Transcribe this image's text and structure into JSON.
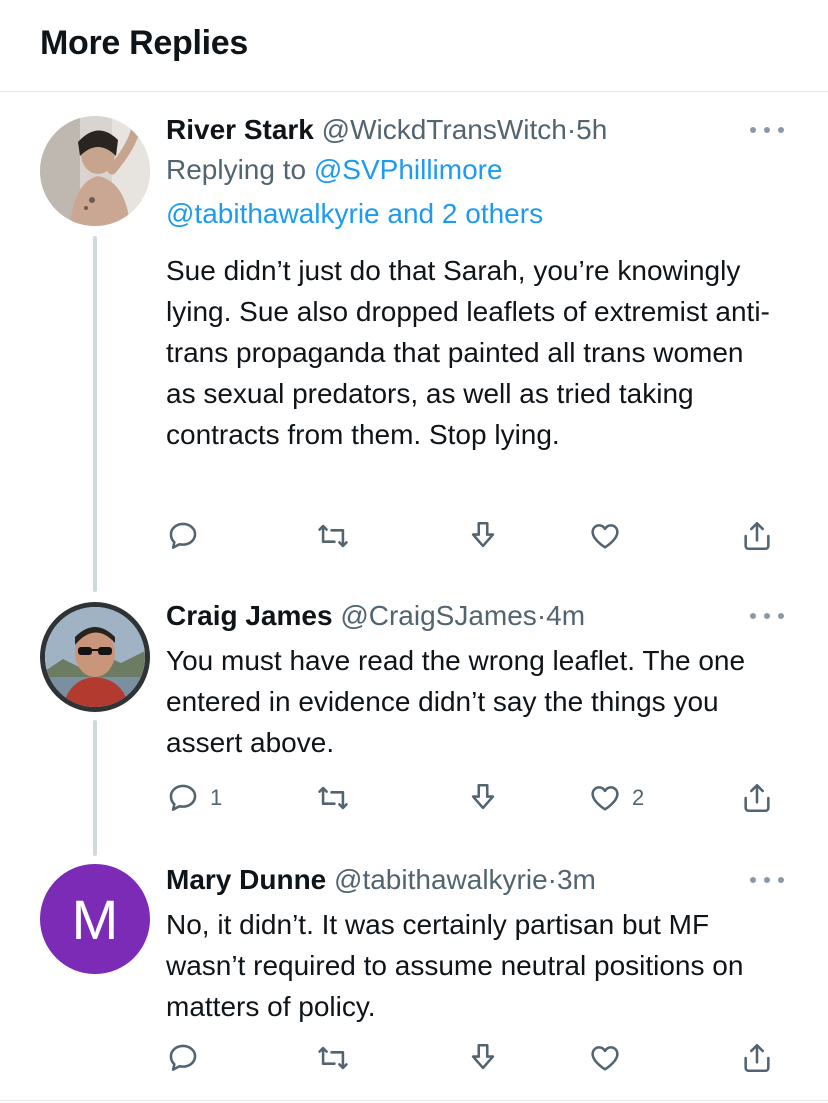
{
  "header": {
    "title": "More Replies"
  },
  "tweets": [
    {
      "name": "River Stark",
      "handle": "@WickdTransWitch",
      "dot": "·",
      "time": "5h",
      "replying_prefix": "Replying to ",
      "replying_to_first": "@SVPhillimore",
      "replying_to_rest": "@tabithawalkyrie and 2 others",
      "text": "Sue didn’t just do that Sarah, you’re knowingly lying. Sue also dropped leaflets of extremist anti-trans propaganda that painted all trans women as sexual predators, as well as tried taking contracts from them. Stop lying.",
      "reply_count": "",
      "retweet_count": "",
      "like_count": ""
    },
    {
      "name": "Craig James",
      "handle": "@CraigSJames",
      "dot": "·",
      "time": "4m",
      "text": "You must have read the wrong leaflet. The one entered in evidence didn’t say the things you assert above.",
      "reply_count": "1",
      "retweet_count": "",
      "like_count": "2"
    },
    {
      "name": "Mary Dunne",
      "handle": "@tabithawalkyrie",
      "dot": "·",
      "time": "3m",
      "avatar_letter": "M",
      "text": "No, it didn’t. It was certainly partisan but MF wasn’t required to assume neutral positions on matters of policy.",
      "reply_count": "",
      "retweet_count": "",
      "like_count": ""
    }
  ],
  "icons": {
    "reply": "reply-icon",
    "retweet": "retweet-icon",
    "downvote": "downvote-icon",
    "like": "heart-icon",
    "share": "share-icon",
    "more": "more-options-icon"
  },
  "colors": {
    "link": "#1d9bf0",
    "secondary_text": "#536471",
    "avatar_m": "#7b2bb5",
    "thread_line": "#cfd9de"
  }
}
